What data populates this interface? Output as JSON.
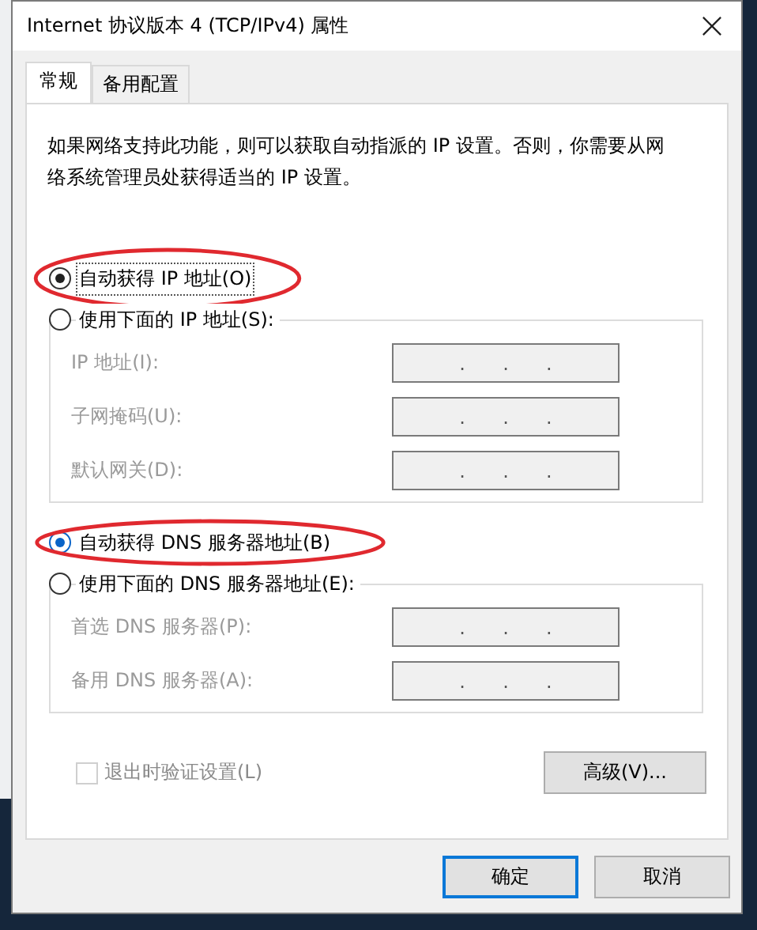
{
  "window": {
    "title": "Internet 协议版本 4 (TCP/IPv4) 属性"
  },
  "tabs": [
    {
      "label": "常规",
      "selected": true
    },
    {
      "label": "备用配置",
      "selected": false
    }
  ],
  "description": "如果网络支持此功能，则可以获取自动指派的 IP 设置。否则，你需要从网络系统管理员处获得适当的 IP 设置。",
  "sections": [
    {
      "options": [
        {
          "label": "自动获得 IP 地址(O)",
          "selected": true,
          "highlighted": true,
          "focused": true
        },
        {
          "label": "使用下面的 IP 地址(S):",
          "selected": false,
          "highlighted": false,
          "focused": false
        }
      ],
      "fields": [
        {
          "label": "IP 地址(I):",
          "disabled": true,
          "separators": [
            ".",
            ".",
            "."
          ]
        },
        {
          "label": "子网掩码(U):",
          "disabled": true,
          "separators": [
            ".",
            ".",
            "."
          ]
        },
        {
          "label": "默认网关(D):",
          "disabled": true,
          "separators": [
            ".",
            ".",
            "."
          ]
        }
      ]
    },
    {
      "options": [
        {
          "label": "自动获得 DNS 服务器地址(B)",
          "selected": true,
          "highlighted": true,
          "focused": false
        },
        {
          "label": "使用下面的 DNS 服务器地址(E):",
          "selected": false,
          "highlighted": false,
          "focused": false
        }
      ],
      "fields": [
        {
          "label": "首选 DNS 服务器(P):",
          "disabled": true,
          "separators": [
            ".",
            ".",
            "."
          ]
        },
        {
          "label": "备用 DNS 服务器(A):",
          "disabled": true,
          "separators": [
            ".",
            ".",
            "."
          ]
        }
      ]
    }
  ],
  "validate_checkbox": {
    "label": "退出时验证设置(L)",
    "checked": false,
    "disabled": true
  },
  "advanced_button": "高级(V)...",
  "buttons": [
    {
      "label": "确定",
      "default": true
    },
    {
      "label": "取消",
      "default": false
    }
  ]
}
